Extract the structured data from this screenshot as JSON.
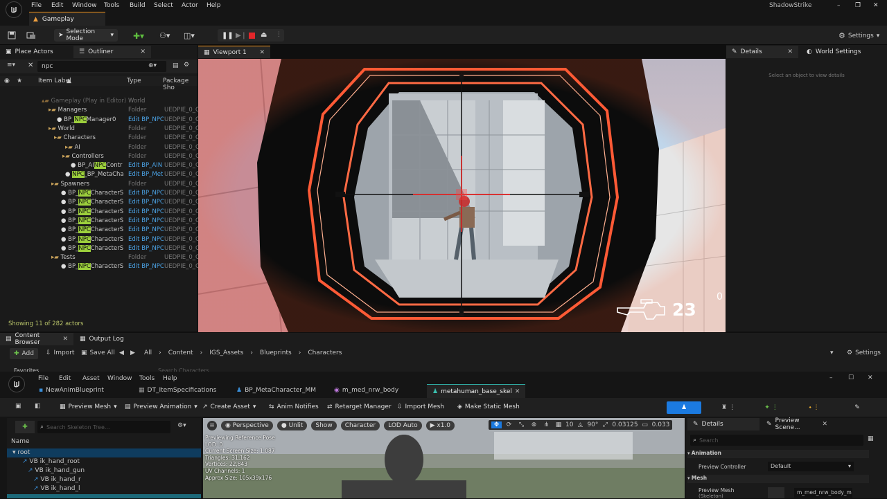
{
  "app": {
    "project_name": "ShadowStrike",
    "menu": [
      "File",
      "Edit",
      "Window",
      "Tools",
      "Build",
      "Select",
      "Actor",
      "Help"
    ],
    "level_tab": "Gameplay",
    "window_controls": [
      "–",
      "❐",
      "✕"
    ]
  },
  "toolbar": {
    "selection_mode": "Selection Mode",
    "settings": "Settings"
  },
  "outliner_panel": {
    "tab_place_actors": "Place Actors",
    "tab_outliner": "Outliner",
    "search_value": "npc",
    "columns": [
      "Item Label",
      "Type",
      "Package Sho"
    ],
    "rows": [
      {
        "label": "Gameplay (Play in Editor)",
        "type": "World",
        "pkg": "",
        "hl": "",
        "suffix": ""
      },
      {
        "label": "Managers",
        "type": "Folder",
        "pkg": "UEDPIE_0_C",
        "hl": "",
        "suffix": ""
      },
      {
        "label": "BP_",
        "hl": "NPC",
        "suffix": "Manager0",
        "type": "Edit BP_NPC",
        "pkg": "UEDPIE_0_C"
      },
      {
        "label": "World",
        "type": "Folder",
        "pkg": "UEDPIE_0_C",
        "hl": "",
        "suffix": ""
      },
      {
        "label": "Characters",
        "type": "Folder",
        "pkg": "UEDPIE_0_C",
        "hl": "",
        "suffix": ""
      },
      {
        "label": "AI",
        "type": "Folder",
        "pkg": "UEDPIE_0_C",
        "hl": "",
        "suffix": ""
      },
      {
        "label": "Controllers",
        "type": "Folder",
        "pkg": "UEDPIE_0_C",
        "hl": "",
        "suffix": ""
      },
      {
        "label": "BP_AI",
        "hl": "NPC",
        "suffix": "Contr",
        "type": "Edit BP_AIN",
        "pkg": "UEDPIE_0_C"
      },
      {
        "label": "",
        "hl": "NPC",
        "suffix": "_BP_MetaCha",
        "type": "Edit BP_Met",
        "pkg": "UEDPIE_0_C"
      },
      {
        "label": "Spawners",
        "type": "Folder",
        "pkg": "UEDPIE_0_C",
        "hl": "",
        "suffix": ""
      },
      {
        "label": "BP_",
        "hl": "NPC",
        "suffix": "CharacterS",
        "type": "Edit BP_NPC",
        "pkg": "UEDPIE_0_C"
      },
      {
        "label": "BP_",
        "hl": "NPC",
        "suffix": "CharacterS",
        "type": "Edit BP_NPC",
        "pkg": "UEDPIE_0_C"
      },
      {
        "label": "BP_",
        "hl": "NPC",
        "suffix": "CharacterS",
        "type": "Edit BP_NPC",
        "pkg": "UEDPIE_0_C"
      },
      {
        "label": "BP_",
        "hl": "NPC",
        "suffix": "CharacterS",
        "type": "Edit BP_NPC",
        "pkg": "UEDPIE_0_C"
      },
      {
        "label": "BP_",
        "hl": "NPC",
        "suffix": "CharacterS",
        "type": "Edit BP_NPC",
        "pkg": "UEDPIE_0_C"
      },
      {
        "label": "BP_",
        "hl": "NPC",
        "suffix": "CharacterS",
        "type": "Edit BP_NPC",
        "pkg": "UEDPIE_0_C"
      },
      {
        "label": "BP_",
        "hl": "NPC",
        "suffix": "CharacterS",
        "type": "Edit BP_NPC",
        "pkg": "UEDPIE_0_C"
      },
      {
        "label": "Tests",
        "type": "Folder",
        "pkg": "UEDPIE_0_C",
        "hl": "",
        "suffix": ""
      },
      {
        "label": "BP_",
        "hl": "NPC",
        "suffix": "CharacterS",
        "type": "Edit BP_NPC",
        "pkg": "UEDPIE_0_C"
      }
    ],
    "status": "Showing 11 of 282 actors"
  },
  "viewport": {
    "tab": "Viewport 1",
    "ammo": "23",
    "score": "0"
  },
  "details_panel": {
    "tab_details": "Details",
    "tab_world_settings": "World Settings",
    "empty_hint": "Select an object to view details"
  },
  "content_browser": {
    "tab": "Content Browser",
    "tab_output": "Output Log",
    "add": "Add",
    "import": "Import",
    "save_all": "Save All",
    "path": [
      "All",
      "Content",
      "IGS_Assets",
      "Blueprints",
      "Characters"
    ],
    "settings": "Settings",
    "favorites": "Favorites",
    "search_placeholder": "Search Characters"
  },
  "anim_editor": {
    "menu": [
      "File",
      "Edit",
      "Asset",
      "Window",
      "Tools",
      "Help"
    ],
    "tabs": [
      "NewAnimBlueprint",
      "DT_ItemSpecifications",
      "BP_MetaCharacter_MM",
      "m_med_nrw_body",
      "metahuman_base_skel"
    ],
    "toolbar": [
      "Preview Mesh",
      "Preview Animation",
      "Create Asset",
      "Anim Notifies",
      "Retarget Manager",
      "Import Mesh",
      "Make Static Mesh"
    ],
    "tree_search_placeholder": "Search Skeleton Tree...",
    "tree_header": "Name",
    "tree": [
      "root",
      "VB ik_hand_root",
      "VB ik_hand_gun",
      "VB ik_hand_r",
      "VB ik_hand_l",
      "pelvis"
    ],
    "vp_buttons": [
      "Perspective",
      "Unlit",
      "Show",
      "Character",
      "LOD Auto",
      "x1.0"
    ],
    "vp_numbers": [
      "10",
      "90°",
      "0.03125",
      "0.033"
    ],
    "stats": [
      "Previewing Reference Pose",
      "LOD: 0",
      "Current Screen Size: 1.087",
      "Triangles: 31,162",
      "Vertices: 22,843",
      "UV Channels: 1",
      "Approx Size: 105x39x176"
    ],
    "details_tab": "Details",
    "preview_tab": "Preview Scene...",
    "details_search_placeholder": "Search",
    "section_animation": "Animation",
    "preview_controller_label": "Preview Controller",
    "preview_controller_value": "Default",
    "section_mesh": "Mesh",
    "preview_mesh_label": "Preview Mesh",
    "preview_mesh_sub": "(Skeleton)",
    "preview_mesh_value": "m_med_nrw_body_m"
  }
}
